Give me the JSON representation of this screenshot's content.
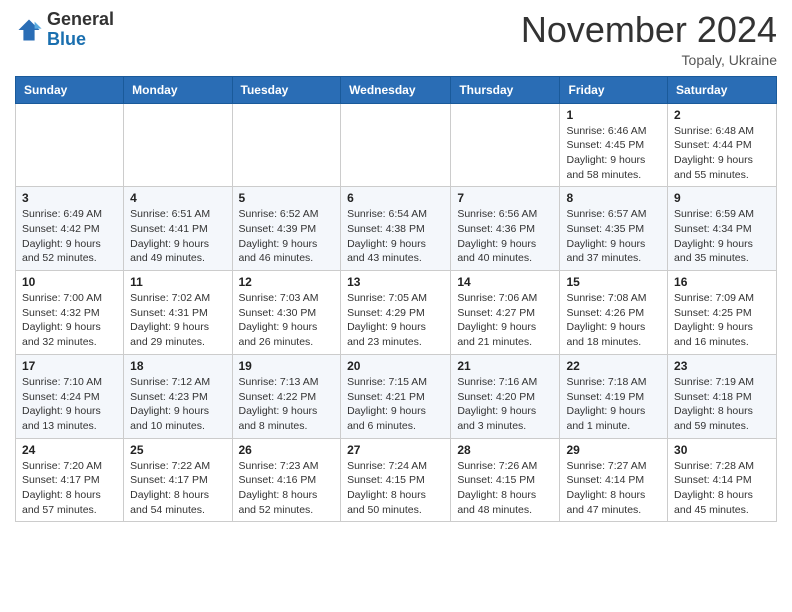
{
  "header": {
    "logo_general": "General",
    "logo_blue": "Blue",
    "month_title": "November 2024",
    "subtitle": "Topaly, Ukraine"
  },
  "weekdays": [
    "Sunday",
    "Monday",
    "Tuesday",
    "Wednesday",
    "Thursday",
    "Friday",
    "Saturday"
  ],
  "weeks": [
    [
      {
        "day": "",
        "info": ""
      },
      {
        "day": "",
        "info": ""
      },
      {
        "day": "",
        "info": ""
      },
      {
        "day": "",
        "info": ""
      },
      {
        "day": "",
        "info": ""
      },
      {
        "day": "1",
        "info": "Sunrise: 6:46 AM\nSunset: 4:45 PM\nDaylight: 9 hours\nand 58 minutes."
      },
      {
        "day": "2",
        "info": "Sunrise: 6:48 AM\nSunset: 4:44 PM\nDaylight: 9 hours\nand 55 minutes."
      }
    ],
    [
      {
        "day": "3",
        "info": "Sunrise: 6:49 AM\nSunset: 4:42 PM\nDaylight: 9 hours\nand 52 minutes."
      },
      {
        "day": "4",
        "info": "Sunrise: 6:51 AM\nSunset: 4:41 PM\nDaylight: 9 hours\nand 49 minutes."
      },
      {
        "day": "5",
        "info": "Sunrise: 6:52 AM\nSunset: 4:39 PM\nDaylight: 9 hours\nand 46 minutes."
      },
      {
        "day": "6",
        "info": "Sunrise: 6:54 AM\nSunset: 4:38 PM\nDaylight: 9 hours\nand 43 minutes."
      },
      {
        "day": "7",
        "info": "Sunrise: 6:56 AM\nSunset: 4:36 PM\nDaylight: 9 hours\nand 40 minutes."
      },
      {
        "day": "8",
        "info": "Sunrise: 6:57 AM\nSunset: 4:35 PM\nDaylight: 9 hours\nand 37 minutes."
      },
      {
        "day": "9",
        "info": "Sunrise: 6:59 AM\nSunset: 4:34 PM\nDaylight: 9 hours\nand 35 minutes."
      }
    ],
    [
      {
        "day": "10",
        "info": "Sunrise: 7:00 AM\nSunset: 4:32 PM\nDaylight: 9 hours\nand 32 minutes."
      },
      {
        "day": "11",
        "info": "Sunrise: 7:02 AM\nSunset: 4:31 PM\nDaylight: 9 hours\nand 29 minutes."
      },
      {
        "day": "12",
        "info": "Sunrise: 7:03 AM\nSunset: 4:30 PM\nDaylight: 9 hours\nand 26 minutes."
      },
      {
        "day": "13",
        "info": "Sunrise: 7:05 AM\nSunset: 4:29 PM\nDaylight: 9 hours\nand 23 minutes."
      },
      {
        "day": "14",
        "info": "Sunrise: 7:06 AM\nSunset: 4:27 PM\nDaylight: 9 hours\nand 21 minutes."
      },
      {
        "day": "15",
        "info": "Sunrise: 7:08 AM\nSunset: 4:26 PM\nDaylight: 9 hours\nand 18 minutes."
      },
      {
        "day": "16",
        "info": "Sunrise: 7:09 AM\nSunset: 4:25 PM\nDaylight: 9 hours\nand 16 minutes."
      }
    ],
    [
      {
        "day": "17",
        "info": "Sunrise: 7:10 AM\nSunset: 4:24 PM\nDaylight: 9 hours\nand 13 minutes."
      },
      {
        "day": "18",
        "info": "Sunrise: 7:12 AM\nSunset: 4:23 PM\nDaylight: 9 hours\nand 10 minutes."
      },
      {
        "day": "19",
        "info": "Sunrise: 7:13 AM\nSunset: 4:22 PM\nDaylight: 9 hours\nand 8 minutes."
      },
      {
        "day": "20",
        "info": "Sunrise: 7:15 AM\nSunset: 4:21 PM\nDaylight: 9 hours\nand 6 minutes."
      },
      {
        "day": "21",
        "info": "Sunrise: 7:16 AM\nSunset: 4:20 PM\nDaylight: 9 hours\nand 3 minutes."
      },
      {
        "day": "22",
        "info": "Sunrise: 7:18 AM\nSunset: 4:19 PM\nDaylight: 9 hours\nand 1 minute."
      },
      {
        "day": "23",
        "info": "Sunrise: 7:19 AM\nSunset: 4:18 PM\nDaylight: 8 hours\nand 59 minutes."
      }
    ],
    [
      {
        "day": "24",
        "info": "Sunrise: 7:20 AM\nSunset: 4:17 PM\nDaylight: 8 hours\nand 57 minutes."
      },
      {
        "day": "25",
        "info": "Sunrise: 7:22 AM\nSunset: 4:17 PM\nDaylight: 8 hours\nand 54 minutes."
      },
      {
        "day": "26",
        "info": "Sunrise: 7:23 AM\nSunset: 4:16 PM\nDaylight: 8 hours\nand 52 minutes."
      },
      {
        "day": "27",
        "info": "Sunrise: 7:24 AM\nSunset: 4:15 PM\nDaylight: 8 hours\nand 50 minutes."
      },
      {
        "day": "28",
        "info": "Sunrise: 7:26 AM\nSunset: 4:15 PM\nDaylight: 8 hours\nand 48 minutes."
      },
      {
        "day": "29",
        "info": "Sunrise: 7:27 AM\nSunset: 4:14 PM\nDaylight: 8 hours\nand 47 minutes."
      },
      {
        "day": "30",
        "info": "Sunrise: 7:28 AM\nSunset: 4:14 PM\nDaylight: 8 hours\nand 45 minutes."
      }
    ]
  ]
}
